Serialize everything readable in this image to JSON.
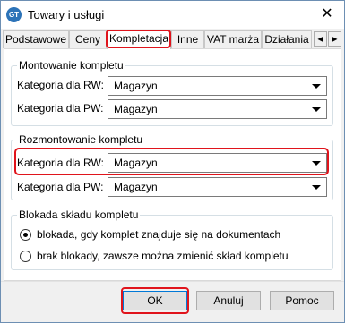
{
  "window": {
    "title": "Towary i usługi",
    "app_icon": "GT"
  },
  "tabs": [
    {
      "label": "Podstawowe"
    },
    {
      "label": "Ceny"
    },
    {
      "label": "Kompletacja"
    },
    {
      "label": "Inne"
    },
    {
      "label": "VAT marża"
    },
    {
      "label": "Działania"
    }
  ],
  "active_tab": "Kompletacja",
  "montowanie": {
    "title": "Montowanie kompletu",
    "rw_label": "Kategoria dla RW:",
    "rw_value": "Magazyn",
    "pw_label": "Kategoria dla PW:",
    "pw_value": "Magazyn"
  },
  "rozmontowanie": {
    "title": "Rozmontowanie kompletu",
    "rw_label": "Kategoria dla RW:",
    "rw_value": "Magazyn",
    "pw_label": "Kategoria dla PW:",
    "pw_value": "Magazyn"
  },
  "blokada": {
    "title": "Blokada składu kompletu",
    "option1": "blokada, gdy komplet znajduje się na dokumentach",
    "option2": "brak blokady, zawsze można zmienić skład kompletu",
    "selected": "option1"
  },
  "buttons": {
    "ok": "OK",
    "cancel": "Anuluj",
    "help": "Pomoc"
  },
  "colors": {
    "highlight": "#e0141c",
    "title_icon": "#2c73b8"
  },
  "icons": {
    "close": "close-icon",
    "tab_prev": "chevron-left-icon",
    "tab_next": "chevron-right-icon",
    "dropdown": "chevron-down-icon"
  }
}
